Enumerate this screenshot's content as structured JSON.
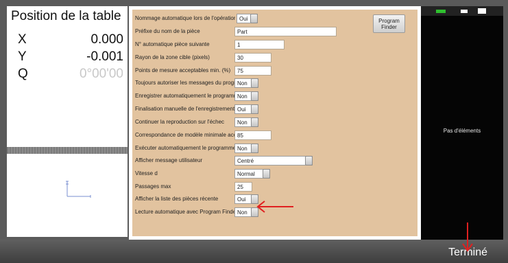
{
  "dro": {
    "title": "Position de la table",
    "rows": [
      {
        "axis": "X",
        "value": "0.000"
      },
      {
        "axis": "Y",
        "value": "-0.001"
      },
      {
        "axis": "Q",
        "value": "0°00'00"
      }
    ]
  },
  "settings": {
    "program_finder_button": [
      "Program",
      "Finder"
    ],
    "rows": [
      {
        "label": "Nommage automatique lors de l'opération Exécu",
        "value": "Oui"
      },
      {
        "label": "Préfixe du nom de la pièce",
        "value": "Part"
      },
      {
        "label": "N° automatique pièce suivante",
        "value": "1"
      },
      {
        "label": "Rayon de la zone cible (pixels)",
        "value": "30"
      },
      {
        "label": "Points de mesure acceptables min. (%)",
        "value": "75"
      },
      {
        "label": "Toujours autoriser les messages du programme",
        "value": "Non"
      },
      {
        "label": "Enregistrer automatiquement le programme après",
        "value": "Non"
      },
      {
        "label": "Finalisation manuelle de l'enregistrement des pièces",
        "value": "Oui"
      },
      {
        "label": "Continuer la reproduction sur l'échec",
        "value": "Non"
      },
      {
        "label": "Correspondance de modèle minimale acceptable",
        "value": "85"
      },
      {
        "label": "Exécuter automatiquement le programme lors",
        "value": "Non"
      },
      {
        "label": "Afficher message utilisateur",
        "value": "Centré"
      },
      {
        "label": "Vitesse d",
        "value": "Normal"
      },
      {
        "label": "Passages max",
        "value": "25"
      },
      {
        "label": "Afficher la liste des pièces récente",
        "value": "Oui"
      },
      {
        "label": "Lecture automatique avec Program Finder",
        "value": "Non"
      }
    ]
  },
  "right_panel": {
    "empty_message": "Pas d'éléments",
    "window_control_colors": [
      "#2fbf2f",
      "#ffffff",
      "#ffffff"
    ]
  },
  "bottom_bar": {
    "done_label": "Terminé"
  },
  "colors": {
    "settings_background": "#e2c39f",
    "annotation_arrow": "#e02020"
  }
}
